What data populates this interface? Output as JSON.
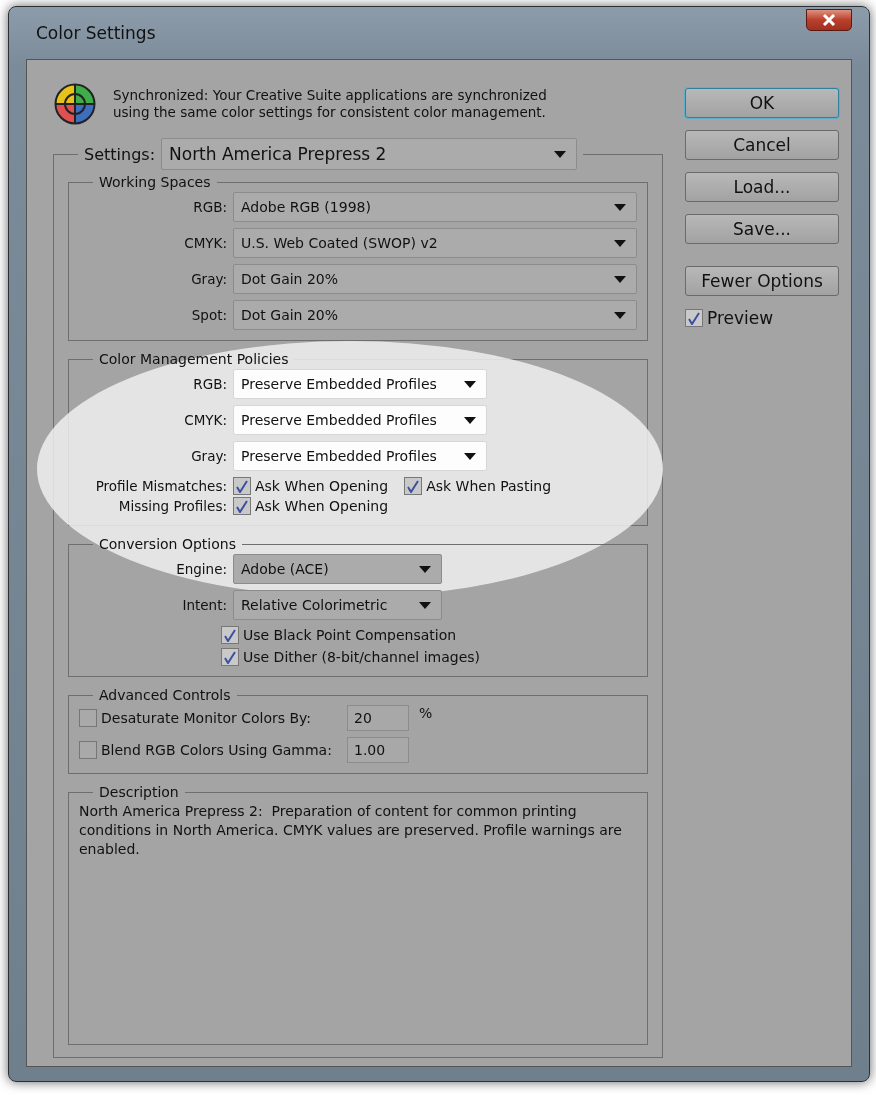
{
  "window": {
    "title": "Color Settings"
  },
  "sync_message": "Synchronized: Your Creative Suite applications are synchronized using the same color settings for consistent color management.",
  "settings": {
    "label": "Settings:",
    "value": "North America Prepress 2"
  },
  "working_spaces": {
    "title": "Working Spaces",
    "rows": [
      {
        "label": "RGB:",
        "value": "Adobe RGB (1998)"
      },
      {
        "label": "CMYK:",
        "value": "U.S. Web Coated (SWOP) v2"
      },
      {
        "label": "Gray:",
        "value": "Dot Gain 20%"
      },
      {
        "label": "Spot:",
        "value": "Dot Gain 20%"
      }
    ]
  },
  "policies": {
    "title": "Color Management Policies",
    "highlighted": true,
    "rows": [
      {
        "label": "RGB:",
        "value": "Preserve Embedded Profiles"
      },
      {
        "label": "CMYK:",
        "value": "Preserve Embedded Profiles"
      },
      {
        "label": "Gray:",
        "value": "Preserve Embedded Profiles"
      }
    ],
    "checks": [
      {
        "label": "Profile Mismatches:",
        "options": [
          {
            "label": "Ask When Opening",
            "checked": true
          },
          {
            "label": "Ask When Pasting",
            "checked": true
          }
        ]
      },
      {
        "label": "Missing Profiles:",
        "options": [
          {
            "label": "Ask When Opening",
            "checked": true
          }
        ]
      }
    ]
  },
  "conversion": {
    "title": "Conversion Options",
    "rows": [
      {
        "label": "Engine:",
        "value": "Adobe (ACE)"
      },
      {
        "label": "Intent:",
        "value": "Relative Colorimetric"
      }
    ],
    "options": [
      {
        "label": "Use Black Point Compensation",
        "checked": true
      },
      {
        "label": "Use Dither (8-bit/channel images)",
        "checked": true
      }
    ]
  },
  "advanced": {
    "title": "Advanced Controls",
    "rows": [
      {
        "label": "Desaturate Monitor Colors By:",
        "checked": false,
        "value": "20",
        "unit": "%"
      },
      {
        "label": "Blend RGB Colors Using Gamma:",
        "checked": false,
        "value": "1.00"
      }
    ]
  },
  "description": {
    "title": "Description",
    "text": "North America Prepress 2:  Preparation of content for common printing conditions in North America. CMYK values are preserved. Profile warnings are enabled."
  },
  "buttons": [
    {
      "label": "OK",
      "default": true
    },
    {
      "label": "Cancel",
      "default": false
    },
    {
      "label": "Load...",
      "default": false
    },
    {
      "label": "Save...",
      "default": false
    },
    {
      "label": "Fewer Options",
      "default": false
    }
  ],
  "preview": {
    "label": "Preview",
    "checked": true
  }
}
